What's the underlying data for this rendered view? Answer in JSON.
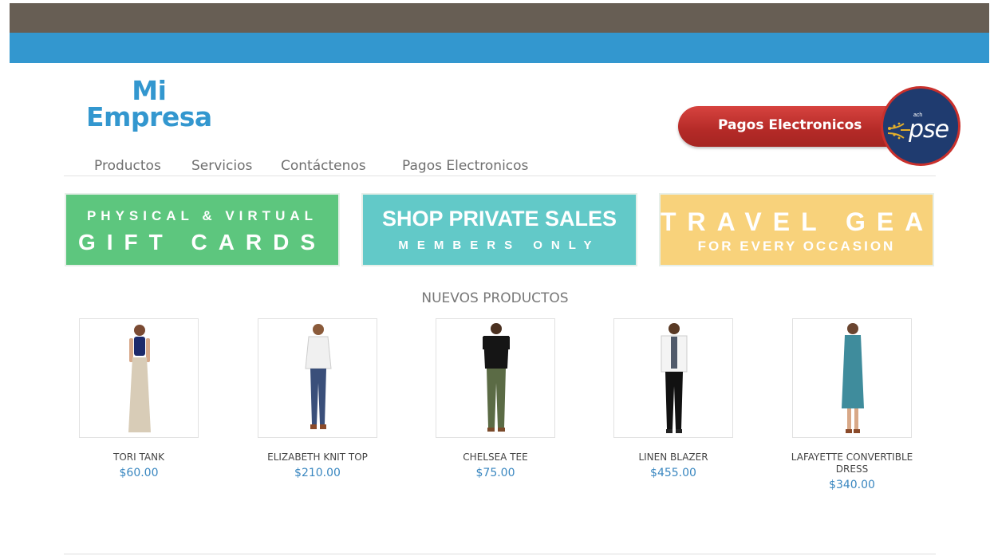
{
  "logo": {
    "line1": "Mi",
    "line2": "Empresa"
  },
  "pse_button": {
    "label": "Pagos Electronicos",
    "badge_small": "ach",
    "badge_text": "pse"
  },
  "nav": {
    "items": [
      {
        "label": "Productos"
      },
      {
        "label": "Servicios"
      },
      {
        "label": "Contáctenos"
      },
      {
        "label": "Pagos Electronicos"
      }
    ]
  },
  "banners": [
    {
      "line1": "PHYSICAL & VIRTUAL",
      "line2": "GIFT CARDS",
      "color": "#5dc67e"
    },
    {
      "line1": "SHOP PRIVATE SALES",
      "line2": "MEMBERS ONLY",
      "color": "#62c9c8"
    },
    {
      "line1": "TRAVEL GEAR",
      "line2": "FOR EVERY OCCASION",
      "color": "#f8d27b"
    }
  ],
  "section_title": "NUEVOS PRODUCTOS",
  "products": [
    {
      "name": "TORI TANK",
      "price": "$60.00"
    },
    {
      "name": "ELIZABETH KNIT TOP",
      "price": "$210.00"
    },
    {
      "name": "CHELSEA TEE",
      "price": "$75.00"
    },
    {
      "name": "LINEN BLAZER",
      "price": "$455.00"
    },
    {
      "name": "LAFAYETTE CONVERTIBLE DRESS",
      "price": "$340.00"
    }
  ],
  "colors": {
    "header_dark": "#675e54",
    "header_blue": "#3397cf",
    "price": "#3a87c0",
    "pse_red": "#c9302c"
  }
}
